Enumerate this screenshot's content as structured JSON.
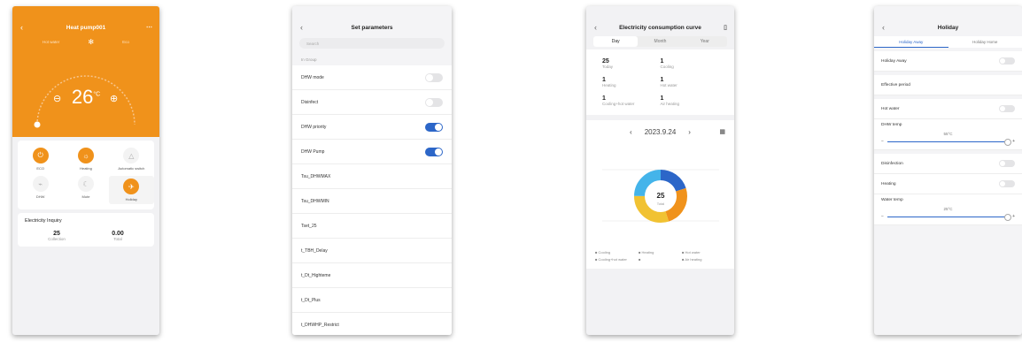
{
  "phone1": {
    "title": "Heat pump001",
    "temp": "26",
    "unit": "°C",
    "modes": [
      "Hot water",
      "",
      "Eco"
    ],
    "buttons": [
      {
        "label": "ECO",
        "state": "on"
      },
      {
        "label": "Heating",
        "state": "on"
      },
      {
        "label": "Automatic switch",
        "state": "off"
      },
      {
        "label": "DHW",
        "state": "off"
      },
      {
        "label": "Mute",
        "state": "off"
      },
      {
        "label": "Holiday",
        "state": "on"
      }
    ],
    "inquiry_title": "Electricity Inquiry",
    "inquiry_values": [
      {
        "value": "25",
        "label": "Collection"
      },
      {
        "value": "0.00",
        "label": "Total"
      }
    ]
  },
  "phone2": {
    "title": "Set parameters",
    "search_placeholder": "Search",
    "section": "In Group",
    "rows": [
      {
        "label": "DHW mode",
        "type": "toggle",
        "on": false
      },
      {
        "label": "Disinfect",
        "type": "toggle",
        "on": false
      },
      {
        "label": "DHW priority",
        "type": "toggle",
        "on": true
      },
      {
        "label": "DHW Pump",
        "type": "toggle",
        "on": true
      },
      {
        "label": "Tsu_DHWMAX",
        "type": "value",
        "value": ""
      },
      {
        "label": "Tsu_DHWMIN",
        "type": "value",
        "value": ""
      },
      {
        "label": "Tset_25",
        "type": "value",
        "value": ""
      },
      {
        "label": "t_TBH_Delay",
        "type": "value",
        "value": ""
      },
      {
        "label": "t_Dt_Highteme",
        "type": "value",
        "value": ""
      },
      {
        "label": "t_Dt_Plus",
        "type": "value",
        "value": ""
      },
      {
        "label": "t_DHWHP_Restrict",
        "type": "value",
        "value": ""
      }
    ]
  },
  "phone3": {
    "title": "Electricity consumption curve",
    "tabs": [
      "Day",
      "Month",
      "Year"
    ],
    "active_tab": 0,
    "stats": [
      {
        "value": "25",
        "label": "Today"
      },
      {
        "value": "1",
        "label": "Cooling"
      },
      {
        "value": "1",
        "label": "Heating"
      },
      {
        "value": "1",
        "label": "Hot water"
      },
      {
        "value": "1",
        "label": "Cooling+hot water"
      },
      {
        "value": "1",
        "label": "Air heating"
      }
    ],
    "date": "2023.9.24",
    "donut_center_value": "25",
    "donut_center_label": "Total",
    "segments": [
      {
        "color": "#2c66c8",
        "fraction": 0.2
      },
      {
        "color": "#f0921b",
        "fraction": 0.25
      },
      {
        "color": "#f1c232",
        "fraction": 0.3
      },
      {
        "color": "#44b4ea",
        "fraction": 0.25
      }
    ],
    "legend": [
      "Cooling",
      "Heating",
      "Hot water",
      "Cooling+hot water",
      "",
      "Air heating"
    ]
  },
  "phone4": {
    "title": "Holiday",
    "tabs": [
      "Holiday Away",
      "Holiday Home"
    ],
    "active_tab": 0,
    "rows": [
      {
        "label": "Holiday Away",
        "type": "toggle"
      },
      {
        "label": "Effective period",
        "type": "value",
        "value": ""
      },
      {
        "label": "Hot water",
        "type": "toggle"
      }
    ],
    "dhw_temp_label": "DHW temp",
    "dhw_temp_value": "55°C",
    "rows2": [
      {
        "label": "Disinfection",
        "type": "toggle"
      },
      {
        "label": "Heating",
        "type": "toggle"
      }
    ],
    "water_temp_label": "Water temp",
    "water_temp_value": "25°C",
    "minus": "−",
    "plus": "+"
  }
}
